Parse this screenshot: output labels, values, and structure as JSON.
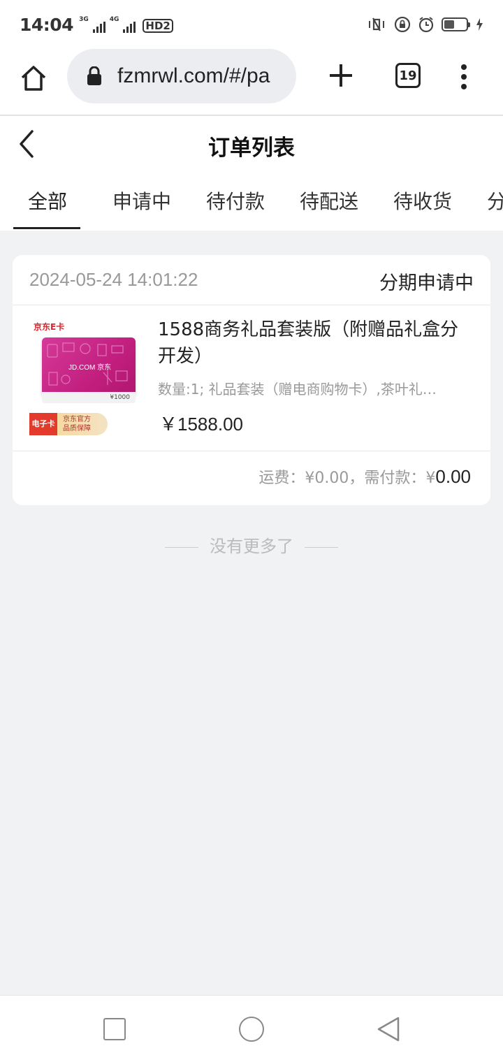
{
  "status_bar": {
    "time": "14:04",
    "net1": "3G",
    "net2": "4G",
    "hd": "HD2"
  },
  "browser": {
    "url": "fzmrwl.com/#/pa",
    "tab_count": "19"
  },
  "header": {
    "title": "订单列表"
  },
  "tabs": [
    {
      "label": "全部",
      "active": true
    },
    {
      "label": "申请中"
    },
    {
      "label": "待付款"
    },
    {
      "label": "待配送"
    },
    {
      "label": "待收货"
    },
    {
      "label": "分"
    }
  ],
  "order": {
    "time": "2024-05-24 14:01:22",
    "status": "分期申请中",
    "thumbnail": {
      "brand": "京东E卡",
      "card_text": "JD.COM 京东",
      "denomination": "¥1000",
      "badge_left": "电子卡",
      "badge_right_1": "京东官方",
      "badge_right_2": "品质保障"
    },
    "product_name": "1588商务礼品套装版（附赠品礼盒分开发）",
    "spec": "数量:1; 礼品套装（赠电商购物卡）,茶叶礼…",
    "price": "￥1588.00",
    "shipping_label": "运费：",
    "shipping_value": "¥0.00",
    "separator": "，",
    "due_label": "需付款：",
    "due_currency": "¥",
    "due_value": "0.00"
  },
  "footer_text": "没有更多了",
  "colors": {
    "background": "#f1f2f4",
    "card": "#ffffff",
    "muted": "#999999",
    "gift_card": "#c21f7f"
  }
}
